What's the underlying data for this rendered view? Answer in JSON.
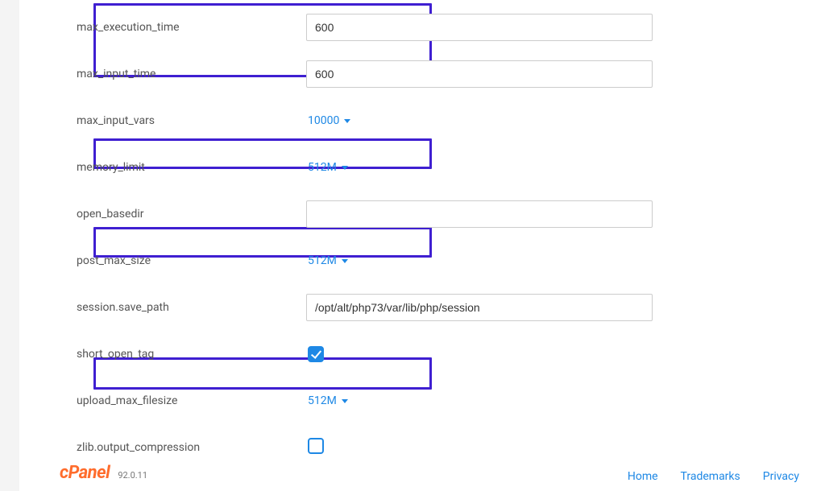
{
  "settings": [
    {
      "key": "max_execution_time",
      "type": "text",
      "value": "600"
    },
    {
      "key": "max_input_time",
      "type": "text",
      "value": "600"
    },
    {
      "key": "max_input_vars",
      "type": "dropdown",
      "value": "10000"
    },
    {
      "key": "memory_limit",
      "type": "dropdown",
      "value": "512M"
    },
    {
      "key": "open_basedir",
      "type": "text",
      "value": ""
    },
    {
      "key": "post_max_size",
      "type": "dropdown",
      "value": "512M"
    },
    {
      "key": "session.save_path",
      "type": "text",
      "value": "/opt/alt/php73/var/lib/php/session"
    },
    {
      "key": "short_open_tag",
      "type": "checkbox",
      "checked": true
    },
    {
      "key": "upload_max_filesize",
      "type": "dropdown",
      "value": "512M"
    },
    {
      "key": "zlib.output_compression",
      "type": "checkbox",
      "checked": false
    }
  ],
  "footer": {
    "logo": "cPanel",
    "version": "92.0.11",
    "links": {
      "home": "Home",
      "trademarks": "Trademarks",
      "privacy": "Privacy"
    }
  }
}
